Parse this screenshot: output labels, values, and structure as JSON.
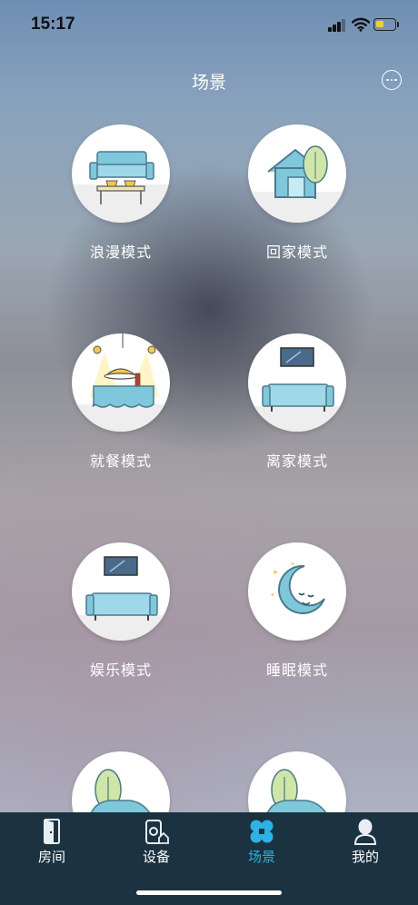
{
  "status_bar": {
    "time": "15:17",
    "battery_level": 0.45,
    "battery_color": "#f4d21c"
  },
  "header": {
    "title": "场景"
  },
  "scenes": [
    {
      "label": "浪漫模式",
      "icon": "sofa-couple-icon"
    },
    {
      "label": "回家模式",
      "icon": "house-icon"
    },
    {
      "label": "就餐模式",
      "icon": "dining-table-icon"
    },
    {
      "label": "离家模式",
      "icon": "sofa-tv-icon"
    },
    {
      "label": "娱乐模式",
      "icon": "sofa-tv-icon"
    },
    {
      "label": "睡眠模式",
      "icon": "moon-icon"
    },
    {
      "label": "",
      "icon": "car-tree-icon"
    },
    {
      "label": "",
      "icon": "car-tree-icon"
    }
  ],
  "tabs": [
    {
      "label": "房间",
      "icon": "door-icon",
      "active": false
    },
    {
      "label": "设备",
      "icon": "device-icon",
      "active": false
    },
    {
      "label": "场景",
      "icon": "scene-icon",
      "active": true
    },
    {
      "label": "我的",
      "icon": "user-icon",
      "active": false
    }
  ],
  "colors": {
    "accent": "#2ab3e4",
    "tab_bar": "#1b3241",
    "illustration_blue": "#7fc8dc"
  }
}
